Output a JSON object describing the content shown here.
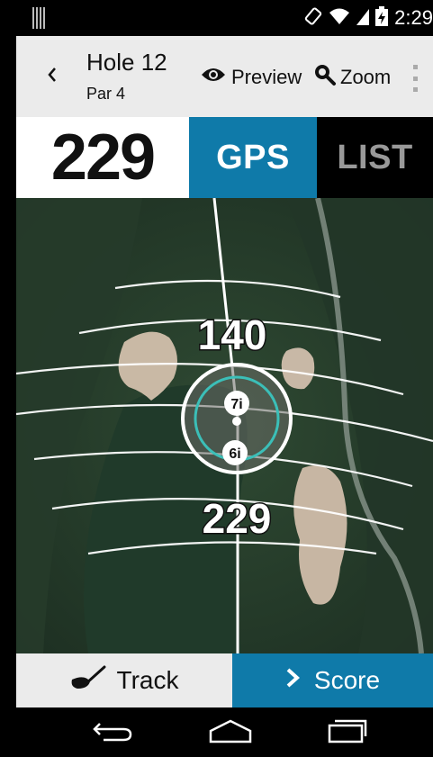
{
  "status_bar": {
    "time": "2:29"
  },
  "header": {
    "back_icon": "chevron-left-icon",
    "title": "Hole 12",
    "par": "Par 4",
    "preview_label": "Preview",
    "zoom_label": "Zoom"
  },
  "distance": {
    "value": "229"
  },
  "tabs": {
    "gps": "GPS",
    "list": "LIST"
  },
  "map": {
    "marker_upper_distance": "140",
    "marker_lower_distance": "229",
    "club_upper": "7i",
    "club_lower": "6i"
  },
  "bottom_bar": {
    "track_label": "Track",
    "score_label": "Score"
  },
  "colors": {
    "accent_blue": "#0f7aa9",
    "teal_ring": "#3bbfb8",
    "header_bg": "#ebebeb"
  }
}
